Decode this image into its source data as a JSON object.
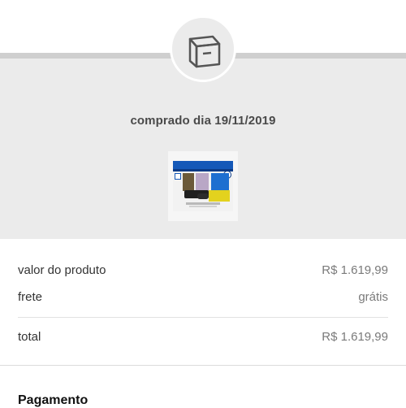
{
  "order": {
    "purchase_date_text": "comprado dia 19/11/2019",
    "product_image_icon": "ps4-bundle-product-image",
    "box_icon": "package-box-icon"
  },
  "summary": {
    "product_value_label": "valor do produto",
    "product_value": "R$ 1.619,99",
    "shipping_label": "frete",
    "shipping_value": "grátis",
    "total_label": "total",
    "total_value": "R$ 1.619,99"
  },
  "payment": {
    "heading": "Pagamento"
  },
  "colors": {
    "gray_section": "#ebebeb",
    "ps4_blue": "#1458b8",
    "text_muted": "#7a7a7a"
  }
}
